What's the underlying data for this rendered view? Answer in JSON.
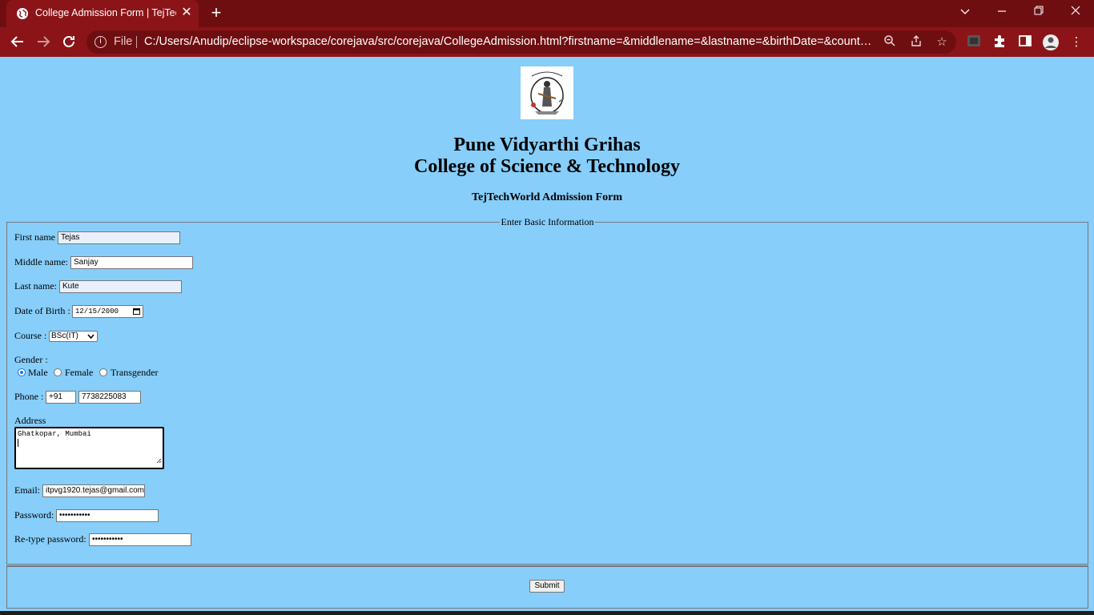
{
  "browser": {
    "tab_title": "College Admission Form | TejTech",
    "new_tab": "+",
    "file_label": "File",
    "url": "C:/Users/Anudip/eclipse-workspace/corejava/src/corejava/CollegeAdmission.html?firstname=&middlename=&lastname=&birthDate=&country+...",
    "colors": {
      "tabstrip": "#6f0e11",
      "toolbar": "#8b1418"
    }
  },
  "page": {
    "college_line1": "Pune Vidyarthi Grihas",
    "college_line2": "College of Science & Technology",
    "form_title": "TejTechWorld Admission Form",
    "legend": "Enter Basic Information",
    "logo_text": "विद्यया अमृतं अश्नुते"
  },
  "form": {
    "first_name_label": "First name",
    "first_name": "Tejas",
    "middle_name_label": "Middle name:",
    "middle_name": "Sanjay",
    "last_name_label": "Last name:",
    "last_name": "Kute",
    "dob_label": "Date of Birth :",
    "dob": "12/15/2000",
    "course_label": "Course :",
    "course": "BSc(IT)",
    "gender_label": "Gender :",
    "gender_options": [
      "Male",
      "Female",
      "Transgender"
    ],
    "gender_selected": "Male",
    "phone_label": "Phone :",
    "phone_code": "+91",
    "phone": "7738225083",
    "address_label": "Address",
    "address": "Ghatkopar, Mumbai",
    "email_label": "Email:",
    "email": "itpvg1920.tejas@gmail.com",
    "password_label": "Password:",
    "password": "•••••••••••",
    "retype_label": "Re-type password:",
    "retype": "•••••••••••",
    "submit": "Submit"
  }
}
